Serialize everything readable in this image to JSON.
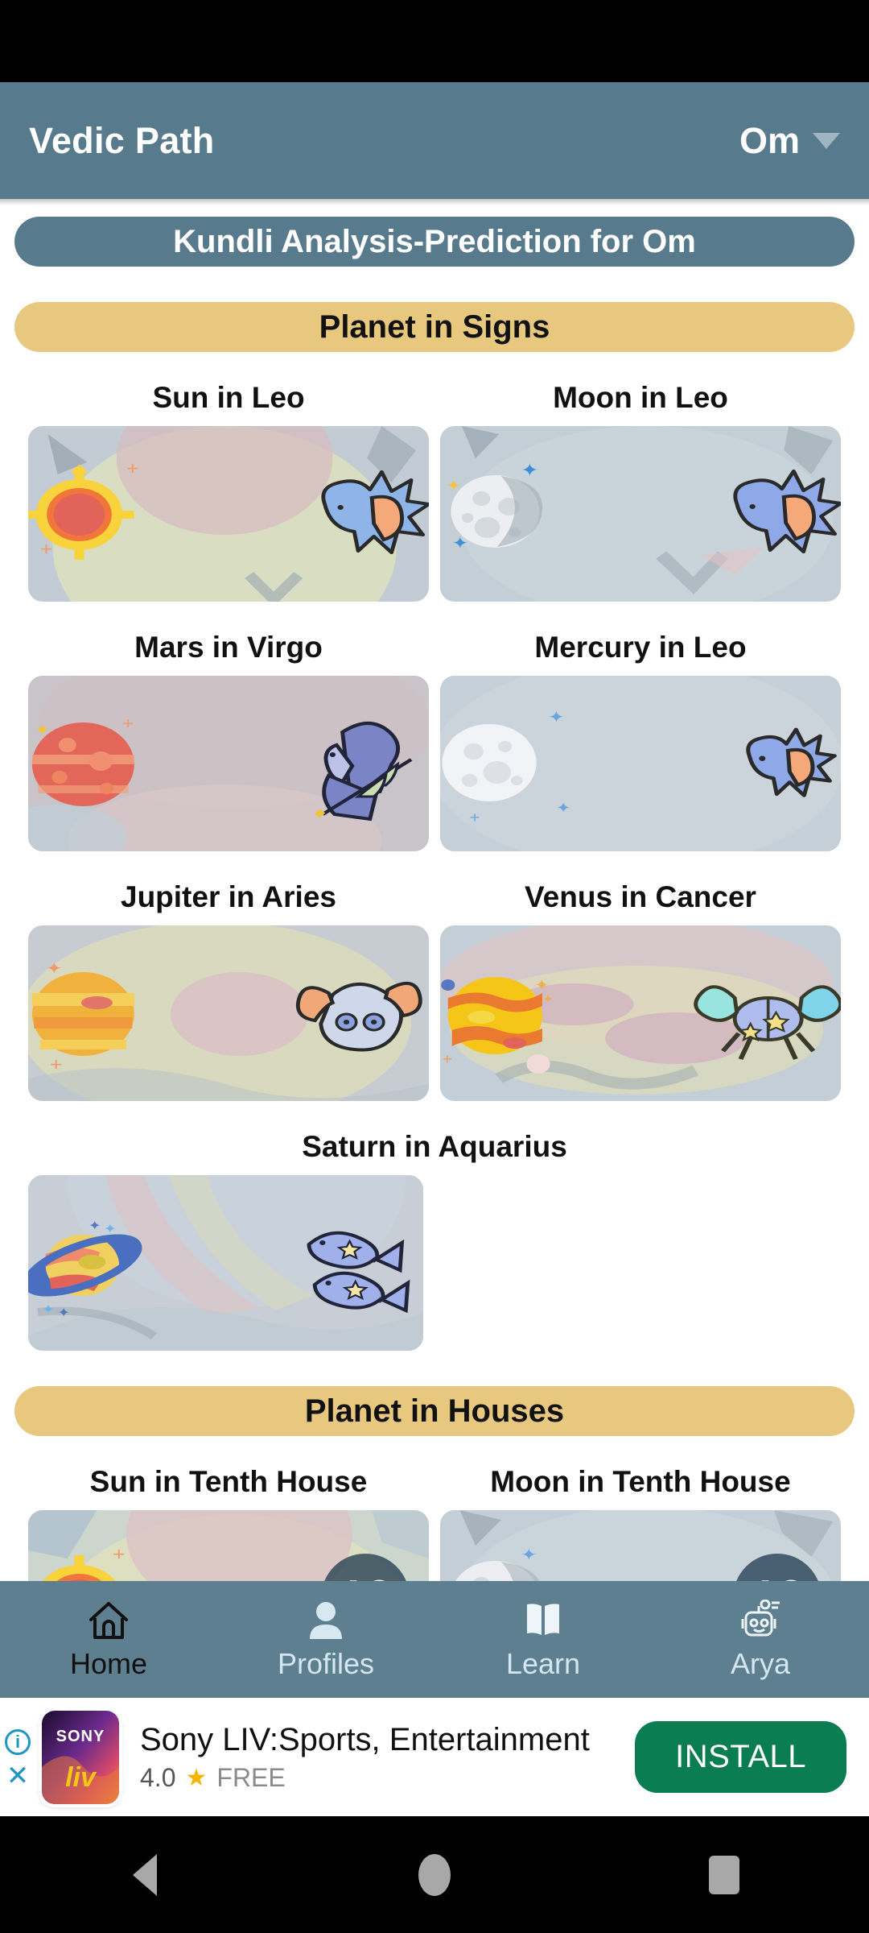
{
  "app": {
    "title": "Vedic Path",
    "profile_name": "Om",
    "profile_dropdown_icon": "chevron-down-icon"
  },
  "page_title": "Kundli Analysis-Prediction for Om",
  "sections": [
    {
      "heading": "Planet in Signs",
      "cards": [
        {
          "label": "Sun in Leo",
          "planet": "sun",
          "sign": "leo",
          "planet_color": "#f4c430",
          "accent": "#e2635a"
        },
        {
          "label": "Moon in Leo",
          "planet": "moon",
          "sign": "leo",
          "planet_color": "#e6e8ec",
          "accent": "#c3c8d0"
        },
        {
          "label": "Mars in Virgo",
          "planet": "mars",
          "sign": "virgo",
          "planet_color": "#e2665a",
          "accent": "#f2a07a"
        },
        {
          "label": "Mercury in Leo",
          "planet": "mercury",
          "sign": "leo",
          "planet_color": "#f0f1f4",
          "accent": "#d5dae2"
        },
        {
          "label": "Jupiter in Aries",
          "planet": "jupiter",
          "sign": "aries",
          "planet_color": "#f0a63c",
          "accent": "#e8c85a"
        },
        {
          "label": "Venus in Cancer",
          "planet": "venus",
          "sign": "cancer",
          "planet_color": "#f5c518",
          "accent": "#e8722e"
        },
        {
          "label": "Saturn in Aquarius",
          "planet": "saturn",
          "sign": "aquarius",
          "planet_color": "#f0d060",
          "accent": "#4a6fc0"
        }
      ]
    },
    {
      "heading": "Planet in Houses",
      "cards": [
        {
          "label": "Sun in Tenth House",
          "planet": "sun",
          "house": "10",
          "planet_color": "#f4c430",
          "accent": "#e2635a"
        },
        {
          "label": "Moon in Tenth House",
          "planet": "moon",
          "house": "10",
          "planet_color": "#e6e8ec",
          "accent": "#c3c8d0"
        }
      ]
    }
  ],
  "bottom_nav": [
    {
      "label": "Home",
      "icon": "home-icon",
      "active": true
    },
    {
      "label": "Profiles",
      "icon": "person-icon",
      "active": false
    },
    {
      "label": "Learn",
      "icon": "book-icon",
      "active": false
    },
    {
      "label": "Arya",
      "icon": "robot-icon",
      "active": false
    }
  ],
  "ad": {
    "info_icon": "info-icon",
    "close_icon": "close-icon",
    "app_icon": "sony-liv-logo",
    "brand_top": "SONY",
    "brand_bottom": "liv",
    "title": "Sony LIV:Sports, Entertainment",
    "rating": "4.0",
    "star_icon": "star-icon",
    "price": "FREE",
    "install_label": "INSTALL"
  },
  "system_nav": [
    {
      "icon": "back-icon"
    },
    {
      "icon": "home-circle-icon"
    },
    {
      "icon": "recents-icon"
    }
  ],
  "colors": {
    "appbar": "#577a8c",
    "section_pill": "#e8c87e",
    "title_pill": "#577a8c",
    "bottom_nav": "#5d7f90",
    "install_green": "#0a7d53",
    "ad_link_blue": "#2196c4"
  }
}
